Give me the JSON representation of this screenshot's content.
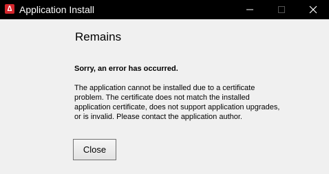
{
  "window": {
    "title": "Application Install",
    "icon": "adobe-air-icon",
    "controls": [
      "minimize-icon",
      "maximize-icon",
      "close-icon"
    ]
  },
  "content": {
    "heading": "Remains",
    "error_title": "Sorry, an error has occurred.",
    "message": "The application cannot be installed due to a certificate\nproblem.  The certificate does not match the installed\napplication certificate, does not support application upgrades,\nor is invalid.  Please contact the application author."
  },
  "buttons": {
    "close_label": "Close"
  },
  "colors": {
    "titlebar_bg": "#000000",
    "window_bg": "#f0f0f0",
    "icon_red": "#d4262c"
  }
}
